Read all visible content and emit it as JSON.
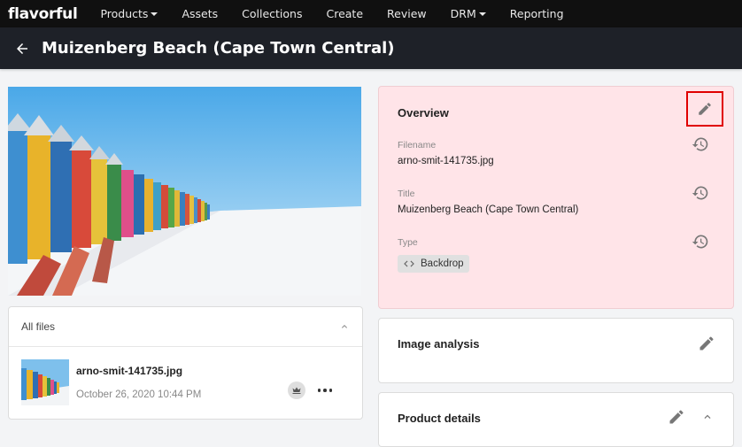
{
  "app": {
    "logo": "flavorful"
  },
  "nav": {
    "items": [
      {
        "label": "Products",
        "dropdown": true
      },
      {
        "label": "Assets",
        "dropdown": false
      },
      {
        "label": "Collections",
        "dropdown": false
      },
      {
        "label": "Create",
        "dropdown": false
      },
      {
        "label": "Review",
        "dropdown": false
      },
      {
        "label": "DRM",
        "dropdown": true
      },
      {
        "label": "Reporting",
        "dropdown": false
      }
    ]
  },
  "header": {
    "title": "Muizenberg Beach (Cape Town Central)"
  },
  "files": {
    "title": "All files",
    "items": [
      {
        "name": "arno-smit-141735.jpg",
        "date": "October 26, 2020 10:44 PM"
      }
    ]
  },
  "overview": {
    "title": "Overview",
    "fields": {
      "filename": {
        "label": "Filename",
        "value": "arno-smit-141735.jpg"
      },
      "title": {
        "label": "Title",
        "value": "Muizenberg Beach (Cape Town Central)"
      },
      "type": {
        "label": "Type",
        "value": "Backdrop"
      }
    }
  },
  "image_analysis": {
    "title": "Image analysis"
  },
  "product_details": {
    "title": "Product details"
  },
  "colors": {
    "topnav": "#101010",
    "header": "#1e2128",
    "overview_bg": "#ffe4e8",
    "highlight": "#e00000"
  }
}
